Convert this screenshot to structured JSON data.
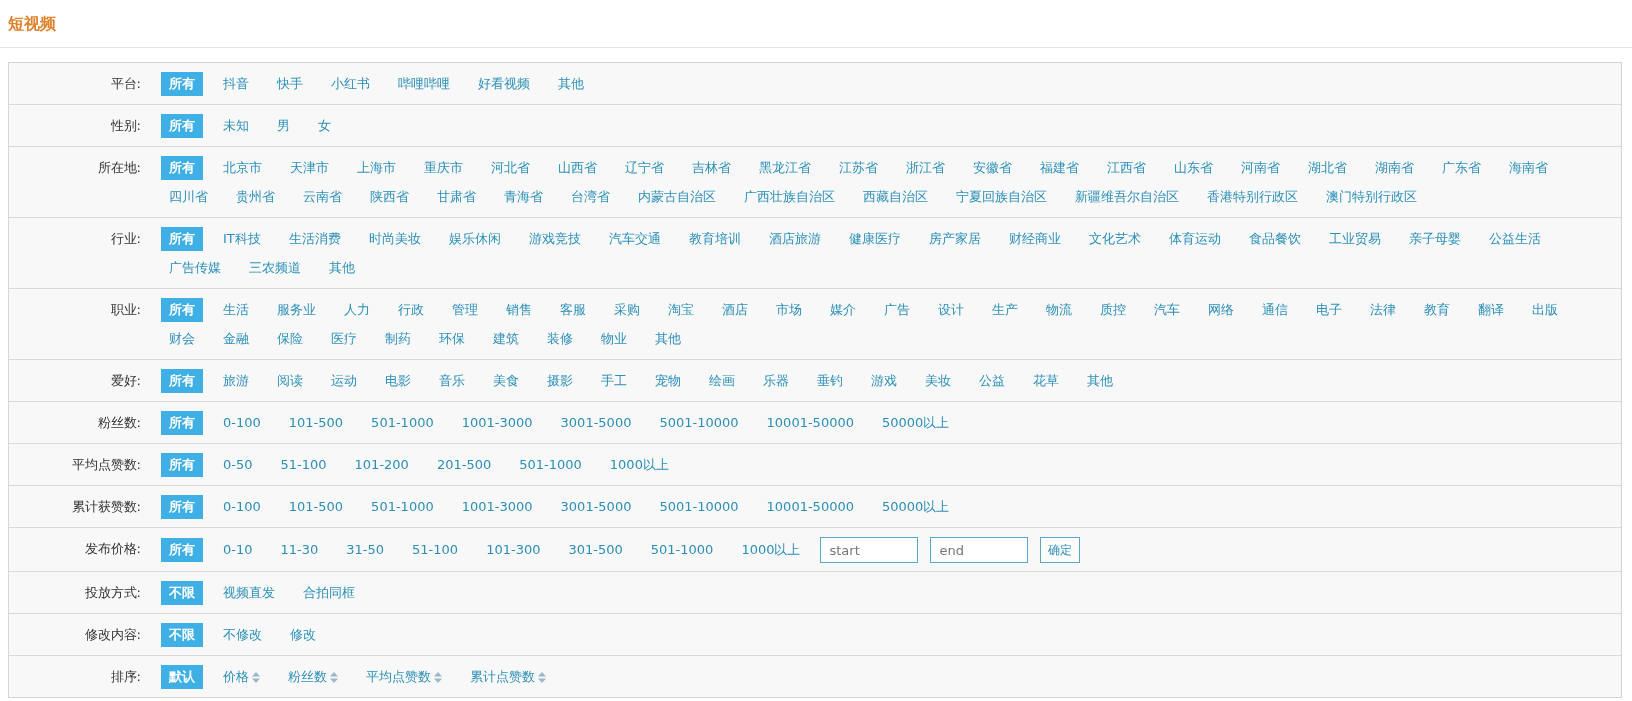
{
  "title": "短视频",
  "rows": [
    {
      "label": "平台:",
      "kind": "options",
      "lines": [
        [
          {
            "text": "所有",
            "selected": true
          },
          {
            "text": "抖音",
            "selected": false
          },
          {
            "text": "快手",
            "selected": false
          },
          {
            "text": "小红书",
            "selected": false
          },
          {
            "text": "哔哩哔哩",
            "selected": false
          },
          {
            "text": "好看视频",
            "selected": false
          },
          {
            "text": "其他",
            "selected": false
          }
        ]
      ]
    },
    {
      "label": "性别:",
      "kind": "options",
      "lines": [
        [
          {
            "text": "所有",
            "selected": true
          },
          {
            "text": "未知",
            "selected": false
          },
          {
            "text": "男",
            "selected": false
          },
          {
            "text": "女",
            "selected": false
          }
        ]
      ]
    },
    {
      "label": "所在地:",
      "kind": "options",
      "lines": [
        [
          {
            "text": "所有",
            "selected": true
          },
          {
            "text": "北京市",
            "selected": false
          },
          {
            "text": "天津市",
            "selected": false
          },
          {
            "text": "上海市",
            "selected": false
          },
          {
            "text": "重庆市",
            "selected": false
          },
          {
            "text": "河北省",
            "selected": false
          },
          {
            "text": "山西省",
            "selected": false
          },
          {
            "text": "辽宁省",
            "selected": false
          },
          {
            "text": "吉林省",
            "selected": false
          },
          {
            "text": "黑龙江省",
            "selected": false
          },
          {
            "text": "江苏省",
            "selected": false
          },
          {
            "text": "浙江省",
            "selected": false
          },
          {
            "text": "安徽省",
            "selected": false
          },
          {
            "text": "福建省",
            "selected": false
          },
          {
            "text": "江西省",
            "selected": false
          },
          {
            "text": "山东省",
            "selected": false
          },
          {
            "text": "河南省",
            "selected": false
          },
          {
            "text": "湖北省",
            "selected": false
          },
          {
            "text": "湖南省",
            "selected": false
          },
          {
            "text": "广东省",
            "selected": false
          },
          {
            "text": "海南省",
            "selected": false
          }
        ],
        [
          {
            "text": "四川省",
            "selected": false
          },
          {
            "text": "贵州省",
            "selected": false
          },
          {
            "text": "云南省",
            "selected": false
          },
          {
            "text": "陕西省",
            "selected": false
          },
          {
            "text": "甘肃省",
            "selected": false
          },
          {
            "text": "青海省",
            "selected": false
          },
          {
            "text": "台湾省",
            "selected": false
          },
          {
            "text": "内蒙古自治区",
            "selected": false
          },
          {
            "text": "广西壮族自治区",
            "selected": false
          },
          {
            "text": "西藏自治区",
            "selected": false
          },
          {
            "text": "宁夏回族自治区",
            "selected": false
          },
          {
            "text": "新疆维吾尔自治区",
            "selected": false
          },
          {
            "text": "香港特别行政区",
            "selected": false
          },
          {
            "text": "澳门特别行政区",
            "selected": false
          }
        ]
      ]
    },
    {
      "label": "行业:",
      "kind": "options",
      "lines": [
        [
          {
            "text": "所有",
            "selected": true
          },
          {
            "text": "IT科技",
            "selected": false
          },
          {
            "text": "生活消费",
            "selected": false
          },
          {
            "text": "时尚美妆",
            "selected": false
          },
          {
            "text": "娱乐休闲",
            "selected": false
          },
          {
            "text": "游戏竞技",
            "selected": false
          },
          {
            "text": "汽车交通",
            "selected": false
          },
          {
            "text": "教育培训",
            "selected": false
          },
          {
            "text": "酒店旅游",
            "selected": false
          },
          {
            "text": "健康医疗",
            "selected": false
          },
          {
            "text": "房产家居",
            "selected": false
          },
          {
            "text": "财经商业",
            "selected": false
          },
          {
            "text": "文化艺术",
            "selected": false
          },
          {
            "text": "体育运动",
            "selected": false
          },
          {
            "text": "食品餐饮",
            "selected": false
          },
          {
            "text": "工业贸易",
            "selected": false
          },
          {
            "text": "亲子母婴",
            "selected": false
          },
          {
            "text": "公益生活",
            "selected": false
          }
        ],
        [
          {
            "text": "广告传媒",
            "selected": false
          },
          {
            "text": "三农频道",
            "selected": false
          },
          {
            "text": "其他",
            "selected": false
          }
        ]
      ]
    },
    {
      "label": "职业:",
      "kind": "options",
      "lines": [
        [
          {
            "text": "所有",
            "selected": true
          },
          {
            "text": "生活",
            "selected": false
          },
          {
            "text": "服务业",
            "selected": false
          },
          {
            "text": "人力",
            "selected": false
          },
          {
            "text": "行政",
            "selected": false
          },
          {
            "text": "管理",
            "selected": false
          },
          {
            "text": "销售",
            "selected": false
          },
          {
            "text": "客服",
            "selected": false
          },
          {
            "text": "采购",
            "selected": false
          },
          {
            "text": "淘宝",
            "selected": false
          },
          {
            "text": "酒店",
            "selected": false
          },
          {
            "text": "市场",
            "selected": false
          },
          {
            "text": "媒介",
            "selected": false
          },
          {
            "text": "广告",
            "selected": false
          },
          {
            "text": "设计",
            "selected": false
          },
          {
            "text": "生产",
            "selected": false
          },
          {
            "text": "物流",
            "selected": false
          },
          {
            "text": "质控",
            "selected": false
          },
          {
            "text": "汽车",
            "selected": false
          },
          {
            "text": "网络",
            "selected": false
          },
          {
            "text": "通信",
            "selected": false
          },
          {
            "text": "电子",
            "selected": false
          },
          {
            "text": "法律",
            "selected": false
          },
          {
            "text": "教育",
            "selected": false
          },
          {
            "text": "翻译",
            "selected": false
          },
          {
            "text": "出版",
            "selected": false
          }
        ],
        [
          {
            "text": "财会",
            "selected": false
          },
          {
            "text": "金融",
            "selected": false
          },
          {
            "text": "保险",
            "selected": false
          },
          {
            "text": "医疗",
            "selected": false
          },
          {
            "text": "制药",
            "selected": false
          },
          {
            "text": "环保",
            "selected": false
          },
          {
            "text": "建筑",
            "selected": false
          },
          {
            "text": "装修",
            "selected": false
          },
          {
            "text": "物业",
            "selected": false
          },
          {
            "text": "其他",
            "selected": false
          }
        ]
      ]
    },
    {
      "label": "爱好:",
      "kind": "options",
      "lines": [
        [
          {
            "text": "所有",
            "selected": true
          },
          {
            "text": "旅游",
            "selected": false
          },
          {
            "text": "阅读",
            "selected": false
          },
          {
            "text": "运动",
            "selected": false
          },
          {
            "text": "电影",
            "selected": false
          },
          {
            "text": "音乐",
            "selected": false
          },
          {
            "text": "美食",
            "selected": false
          },
          {
            "text": "摄影",
            "selected": false
          },
          {
            "text": "手工",
            "selected": false
          },
          {
            "text": "宠物",
            "selected": false
          },
          {
            "text": "绘画",
            "selected": false
          },
          {
            "text": "乐器",
            "selected": false
          },
          {
            "text": "垂钓",
            "selected": false
          },
          {
            "text": "游戏",
            "selected": false
          },
          {
            "text": "美妆",
            "selected": false
          },
          {
            "text": "公益",
            "selected": false
          },
          {
            "text": "花草",
            "selected": false
          },
          {
            "text": "其他",
            "selected": false
          }
        ]
      ]
    },
    {
      "label": "粉丝数:",
      "kind": "options",
      "lines": [
        [
          {
            "text": "所有",
            "selected": true
          },
          {
            "text": "0-100",
            "selected": false
          },
          {
            "text": "101-500",
            "selected": false
          },
          {
            "text": "501-1000",
            "selected": false
          },
          {
            "text": "1001-3000",
            "selected": false
          },
          {
            "text": "3001-5000",
            "selected": false
          },
          {
            "text": "5001-10000",
            "selected": false
          },
          {
            "text": "10001-50000",
            "selected": false
          },
          {
            "text": "50000以上",
            "selected": false
          }
        ]
      ]
    },
    {
      "label": "平均点赞数:",
      "kind": "options",
      "lines": [
        [
          {
            "text": "所有",
            "selected": true
          },
          {
            "text": "0-50",
            "selected": false
          },
          {
            "text": "51-100",
            "selected": false
          },
          {
            "text": "101-200",
            "selected": false
          },
          {
            "text": "201-500",
            "selected": false
          },
          {
            "text": "501-1000",
            "selected": false
          },
          {
            "text": "1000以上",
            "selected": false
          }
        ]
      ]
    },
    {
      "label": "累计获赞数:",
      "kind": "options",
      "lines": [
        [
          {
            "text": "所有",
            "selected": true
          },
          {
            "text": "0-100",
            "selected": false
          },
          {
            "text": "101-500",
            "selected": false
          },
          {
            "text": "501-1000",
            "selected": false
          },
          {
            "text": "1001-3000",
            "selected": false
          },
          {
            "text": "3001-5000",
            "selected": false
          },
          {
            "text": "5001-10000",
            "selected": false
          },
          {
            "text": "10001-50000",
            "selected": false
          },
          {
            "text": "50000以上",
            "selected": false
          }
        ]
      ]
    },
    {
      "label": "发布价格:",
      "kind": "price",
      "lines": [
        [
          {
            "text": "所有",
            "selected": true
          },
          {
            "text": "0-10",
            "selected": false
          },
          {
            "text": "11-30",
            "selected": false
          },
          {
            "text": "31-50",
            "selected": false
          },
          {
            "text": "51-100",
            "selected": false
          },
          {
            "text": "101-300",
            "selected": false
          },
          {
            "text": "301-500",
            "selected": false
          },
          {
            "text": "501-1000",
            "selected": false
          },
          {
            "text": "1000以上",
            "selected": false
          }
        ]
      ],
      "inputs": [
        {
          "placeholder": "start"
        },
        {
          "placeholder": "end"
        }
      ],
      "button": "确定"
    },
    {
      "label": "投放方式:",
      "kind": "options",
      "lines": [
        [
          {
            "text": "不限",
            "selected": true
          },
          {
            "text": "视频直发",
            "selected": false
          },
          {
            "text": "合拍同框",
            "selected": false
          }
        ]
      ]
    },
    {
      "label": "修改内容:",
      "kind": "options",
      "lines": [
        [
          {
            "text": "不限",
            "selected": true
          },
          {
            "text": "不修改",
            "selected": false
          },
          {
            "text": "修改",
            "selected": false
          }
        ]
      ]
    },
    {
      "label": "排序:",
      "kind": "sort",
      "lines": [
        [
          {
            "text": "默认",
            "selected": true
          },
          {
            "text": "价格",
            "selected": false
          },
          {
            "text": "粉丝数",
            "selected": false
          },
          {
            "text": "平均点赞数",
            "selected": false
          },
          {
            "text": "累计点赞数",
            "selected": false
          }
        ]
      ]
    }
  ]
}
